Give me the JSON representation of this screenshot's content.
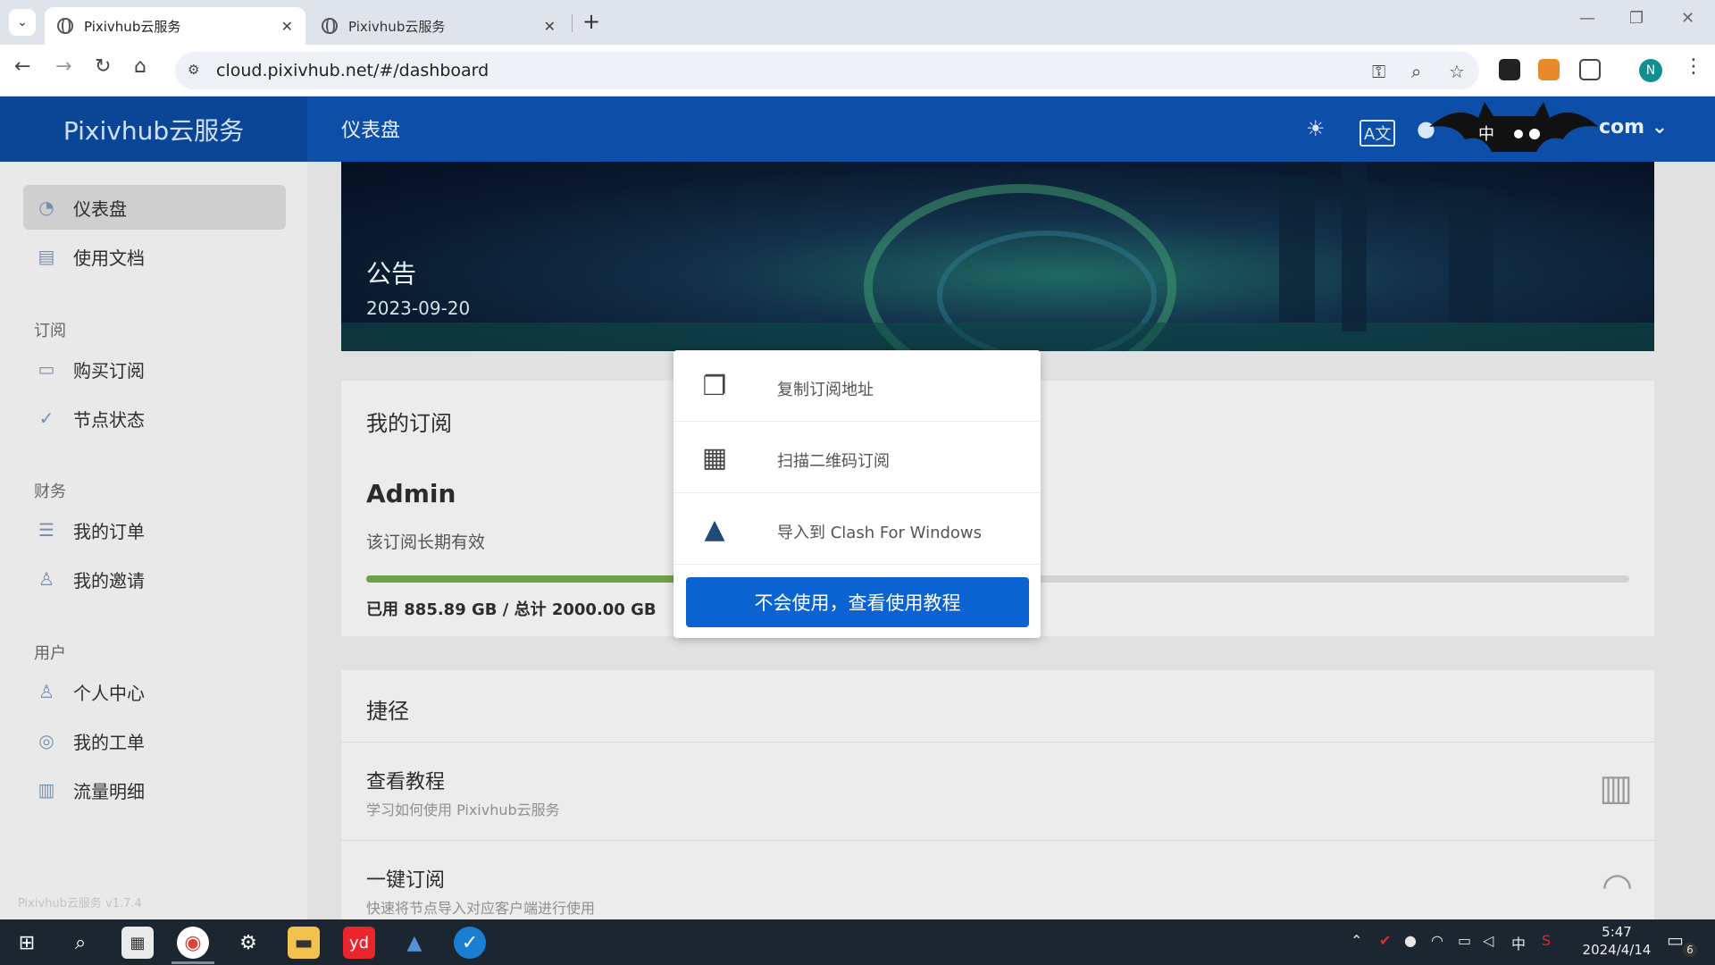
{
  "browser": {
    "tabs": [
      {
        "title": "Pixivhub云服务",
        "active": true
      },
      {
        "title": "Pixivhub云服务",
        "active": false
      }
    ],
    "url": "cloud.pixivhub.net/#/dashboard"
  },
  "app": {
    "brand": "Pixivhub云服务",
    "page_title": "仪表盘",
    "user_label": "com"
  },
  "sidebar": {
    "items_top": [
      {
        "label": "仪表盘"
      },
      {
        "label": "使用文档"
      }
    ],
    "section_subscribe": "订阅",
    "items_subscribe": [
      {
        "label": "购买订阅"
      },
      {
        "label": "节点状态"
      }
    ],
    "section_finance": "财务",
    "items_finance": [
      {
        "label": "我的订单"
      },
      {
        "label": "我的邀请"
      }
    ],
    "section_user": "用户",
    "items_user": [
      {
        "label": "个人中心"
      },
      {
        "label": "我的工单"
      },
      {
        "label": "流量明细"
      }
    ],
    "version": "Pixivhub云服务 v1.7.4"
  },
  "announcement": {
    "title": "公告",
    "date": "2023-09-20"
  },
  "subscription": {
    "card_title": "我的订阅",
    "plan": "Admin",
    "validity": "该订阅长期有效",
    "usage_text": "已用 885.89 GB / 总计 2000.00 GB",
    "used_fraction": 0.443
  },
  "shortcuts": {
    "card_title": "捷径",
    "items": [
      {
        "title": "查看教程",
        "desc": "学习如何使用 Pixivhub云服务"
      },
      {
        "title": "一键订阅",
        "desc": "快速将节点导入对应客户端进行使用"
      }
    ]
  },
  "popup": {
    "items": [
      {
        "label": "复制订阅地址",
        "icon": "copy-icon"
      },
      {
        "label": "扫描二维码订阅",
        "icon": "qrcode-icon"
      },
      {
        "label": "导入到 Clash For Windows",
        "icon": "clash-cat-icon"
      }
    ],
    "button": "不会使用，查看使用教程"
  },
  "taskbar": {
    "time": "5:47",
    "date": "2024/4/14",
    "ime": "中",
    "notifications": "6"
  },
  "colors": {
    "header": "#0d4ea8",
    "primary_button": "#0b63d1",
    "progress": "#6ea04a"
  }
}
